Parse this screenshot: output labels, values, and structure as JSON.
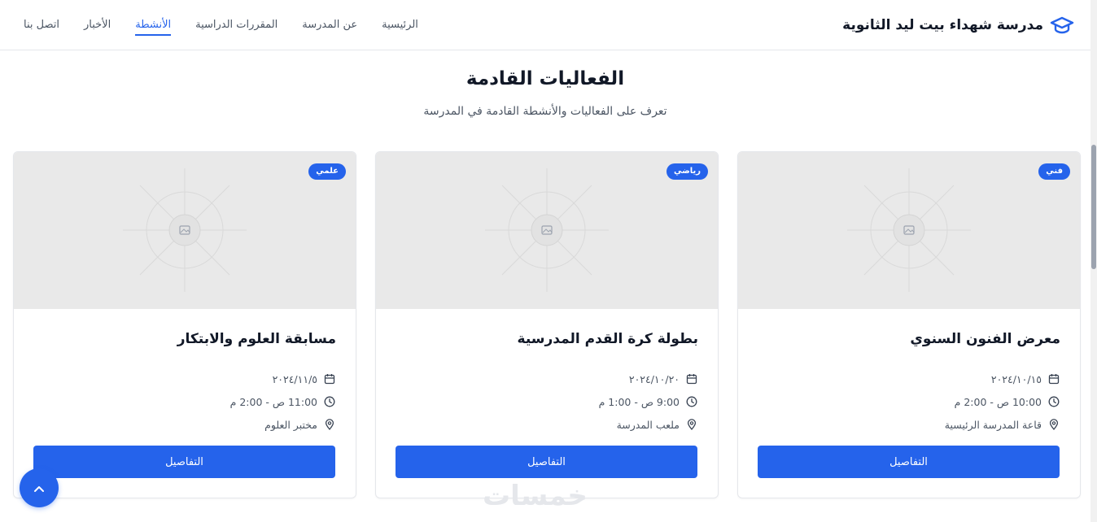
{
  "header": {
    "brand_name": "مدرسة شهداء بيت ليد الثانوية",
    "brand_icon": "graduation-cap-icon",
    "nav": [
      {
        "label": "الرئيسية",
        "active": false
      },
      {
        "label": "عن المدرسة",
        "active": false
      },
      {
        "label": "المقررات الدراسية",
        "active": false
      },
      {
        "label": "الأنشطة",
        "active": true
      },
      {
        "label": "الأخبار",
        "active": false
      },
      {
        "label": "اتصل بنا",
        "active": false
      }
    ]
  },
  "section": {
    "title": "الفعاليات القادمة",
    "subtitle": "تعرف على الفعاليات والأنشطة القادمة في المدرسة"
  },
  "events": [
    {
      "badge": "فني",
      "title": "معرض الفنون السنوي",
      "date": "٢٠٢٤/١٠/١٥",
      "time": "10:00 ص - 2:00 م",
      "place": "قاعة المدرسة الرئيسية",
      "button": "التفاصيل"
    },
    {
      "badge": "رياضي",
      "title": "بطولة كرة القدم المدرسية",
      "date": "٢٠٢٤/١٠/٢٠",
      "time": "9:00 ص - 1:00 م",
      "place": "ملعب المدرسة",
      "button": "التفاصيل"
    },
    {
      "badge": "علمي",
      "title": "مسابقة العلوم والابتكار",
      "date": "٢٠٢٤/١١/٥",
      "time": "11:00 ص - 2:00 م",
      "place": "مختبر العلوم",
      "button": "التفاصيل"
    }
  ],
  "scroll_top_icon": "chevron-up-icon",
  "watermark": "خمسات",
  "colors": {
    "accent": "#2563eb",
    "text": "#111827",
    "muted": "#4b5563",
    "placeholder_bg": "#e9e9e9"
  }
}
